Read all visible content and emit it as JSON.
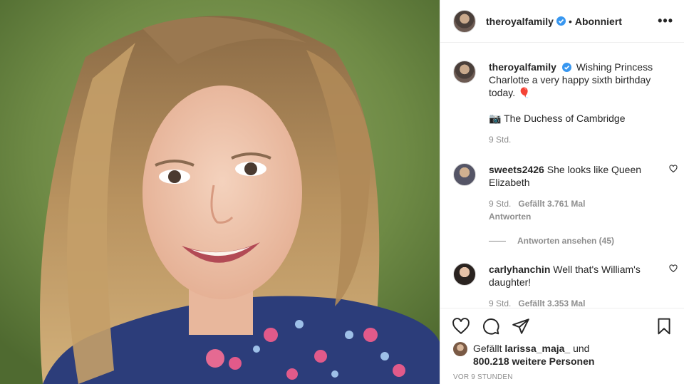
{
  "header": {
    "username": "theroyalfamily",
    "separator": "•",
    "follow_status": "Abonniert",
    "more": "•••"
  },
  "caption": {
    "username": "theroyalfamily",
    "text": "Wishing Princess Charlotte a very happy sixth birthday today. 🎈",
    "credit": "📷 The Duchess of Cambridge",
    "time": "9 Std."
  },
  "comments": [
    {
      "username": "sweets2426",
      "text": "She looks like Queen Elizabeth",
      "time": "9 Std.",
      "likes": "Gefällt 3.761 Mal",
      "reply": "Antworten",
      "view_replies": "Antworten ansehen (45)"
    },
    {
      "username": "carlyhanchin",
      "text": "Well that's William's daughter!",
      "time": "9 Std.",
      "likes": "Gefällt 3.353 Mal"
    }
  ],
  "likes": {
    "prefix": "Gefällt",
    "user": "larissa_maja_",
    "mid": "und",
    "count": "800.218 weitere Personen"
  },
  "timestamp": "VOR 9 STUNDEN",
  "icons": {
    "verified": "verified-badge-icon",
    "heart": "heart-icon",
    "comment": "comment-icon",
    "share": "share-icon",
    "bookmark": "bookmark-icon"
  },
  "colors": {
    "verified": "#3897f0",
    "muted": "#8e8e8e",
    "text": "#262626"
  }
}
